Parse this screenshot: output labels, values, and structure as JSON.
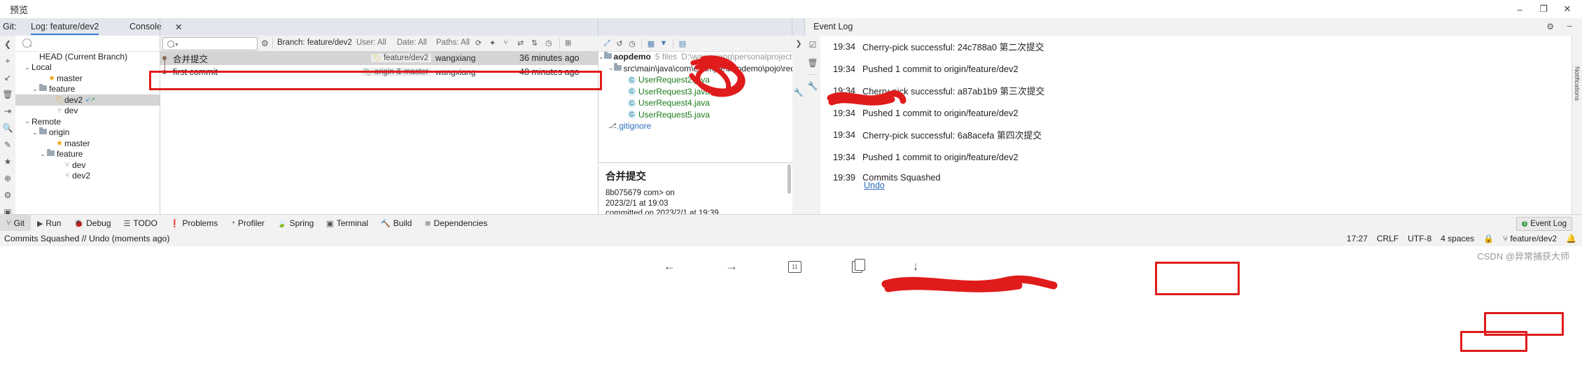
{
  "window": {
    "title": "预览",
    "minimize": "–",
    "maximize": "❐",
    "close": "✕"
  },
  "tabs": {
    "git_label": "Git:",
    "log_label": "Log: feature/dev2",
    "console_label": "Console",
    "close_icon": "✕"
  },
  "left_toolbar": [
    {
      "name": "collapse-icon",
      "glyph": "❮"
    },
    {
      "name": "add-icon",
      "glyph": "+"
    },
    {
      "name": "checkout-icon",
      "glyph": "↙"
    },
    {
      "name": "delete-icon",
      "glyph": "🗑"
    },
    {
      "name": "rebase-icon",
      "glyph": "⇥"
    },
    {
      "name": "search-icon",
      "glyph": "🔍"
    },
    {
      "name": "edit-icon",
      "glyph": "✎"
    },
    {
      "name": "favorite-icon",
      "glyph": "★"
    },
    {
      "name": "globe-icon",
      "glyph": "⊕"
    },
    {
      "name": "settings-icon",
      "glyph": "⚙"
    },
    {
      "name": "window-icon",
      "glyph": "▣"
    },
    {
      "name": "expand-icon",
      "glyph": "»"
    }
  ],
  "branch_tree": {
    "search_placeholder": "",
    "items": [
      {
        "label": "HEAD (Current Branch)",
        "indent": 2,
        "icon": "none",
        "chevron": "",
        "selected": false
      },
      {
        "label": "Local",
        "indent": 1,
        "icon": "none",
        "chevron": "⌄",
        "selected": false
      },
      {
        "label": "master",
        "indent": 3,
        "icon": "star",
        "chevron": "",
        "selected": false
      },
      {
        "label": "feature",
        "indent": 2,
        "icon": "folder",
        "chevron": "⌄",
        "selected": false
      },
      {
        "label": "dev2",
        "indent": 4,
        "icon": "tag",
        "chevron": "",
        "selected": true,
        "arrows": true
      },
      {
        "label": "dev",
        "indent": 4,
        "icon": "branch",
        "chevron": "",
        "selected": false
      },
      {
        "label": "Remote",
        "indent": 1,
        "icon": "none",
        "chevron": "⌄",
        "selected": false
      },
      {
        "label": "origin",
        "indent": 2,
        "icon": "folder",
        "chevron": "⌄",
        "selected": false
      },
      {
        "label": "master",
        "indent": 4,
        "icon": "star",
        "chevron": "",
        "selected": false
      },
      {
        "label": "feature",
        "indent": 3,
        "icon": "folder",
        "chevron": "⌄",
        "selected": false
      },
      {
        "label": "dev",
        "indent": 5,
        "icon": "branch",
        "chevron": "",
        "selected": false
      },
      {
        "label": "dev2",
        "indent": 5,
        "icon": "branch",
        "chevron": "",
        "selected": false
      }
    ]
  },
  "log_toolbar": {
    "search_placeholder": "",
    "gear_icon": "⚙",
    "filters": [
      {
        "name": "branch-filter",
        "key": "Branch:",
        "value": "feature/dev2"
      },
      {
        "name": "user-filter",
        "key": "User:",
        "value": "All"
      },
      {
        "name": "date-filter",
        "key": "Date:",
        "value": "All"
      },
      {
        "name": "paths-filter",
        "key": "Paths:",
        "value": "All"
      }
    ],
    "icons": [
      {
        "name": "refresh-icon",
        "glyph": "⟳"
      },
      {
        "name": "highlight-icon",
        "glyph": "✦"
      },
      {
        "name": "branch-graph-icon",
        "glyph": "⑂"
      },
      {
        "name": "compare-icon",
        "glyph": "⇄"
      },
      {
        "name": "intellisort-icon",
        "glyph": "⇅"
      },
      {
        "name": "clock-icon",
        "glyph": "◷"
      },
      {
        "name": "new-tab-icon",
        "glyph": "⊞"
      },
      {
        "name": "collapse-all-icon",
        "glyph": "⊟"
      },
      {
        "name": "expand-all-icon",
        "glyph": "⊞"
      },
      {
        "name": "pause-icon",
        "glyph": "❚❚"
      },
      {
        "name": "find-icon",
        "glyph": "🔍"
      }
    ]
  },
  "commits": {
    "rows": [
      {
        "subject": "合并提交",
        "label": "feature/dev2",
        "label_color": "yellow",
        "author": "wangxiang",
        "date": "36 minutes ago",
        "selected": true
      },
      {
        "subject": "first commit",
        "label": "origin & master",
        "label_color": "green",
        "author": "wangxiang",
        "date": "48 minutes ago",
        "selected": false
      }
    ]
  },
  "changes_panel": {
    "toolbar_icons": [
      {
        "name": "expand-selection-icon",
        "glyph": "⤢"
      },
      {
        "name": "revert-icon",
        "glyph": "↺"
      },
      {
        "name": "history-icon",
        "glyph": "◷"
      },
      {
        "name": "group-by-icon",
        "glyph": "▦"
      },
      {
        "name": "filter-icon",
        "glyph": "▼"
      },
      {
        "name": "view-options-icon",
        "glyph": "▤"
      }
    ],
    "root": {
      "name": "aopdemo",
      "files": "5 files",
      "path": "D:\\wangxiang\\personalproject\\aopd"
    },
    "folder": "src\\main\\java\\com\\example\\aopdemo\\pojo\\reques",
    "files": [
      "UserRequest2.java",
      "UserRequest3.java",
      "UserRequest4.java",
      "UserRequest5.java"
    ],
    "gitignore": ".gitignore"
  },
  "commit_detail": {
    "title": "合并提交",
    "hash": "8b075679",
    "redacted_author": "",
    "suffix": "com> on",
    "date_line": "2023/2/1 at 19:03",
    "committed_line": "committed on 2023/2/1 at 19:39"
  },
  "right_gutter_icons": [
    {
      "name": "collapse-right-icon",
      "glyph": "❯"
    },
    {
      "name": "wrench-icon",
      "glyph": "🔧"
    }
  ],
  "event_log": {
    "title": "Event Log",
    "gear_icon": "⚙",
    "minimize_icon": "–",
    "toolbar_icons": [
      {
        "name": "mark-read-icon",
        "glyph": "☑"
      },
      {
        "name": "clear-all-icon",
        "glyph": "🗑"
      },
      {
        "name": "settings-wrench-icon",
        "glyph": "🔧"
      }
    ],
    "entries": [
      {
        "time": "19:34",
        "message": "Cherry-pick successful: 24c788a0 第二次提交",
        "link": "",
        "highlighted": false
      },
      {
        "time": "19:34",
        "message": "Pushed 1 commit to origin/feature/dev2",
        "link": "",
        "highlighted": false
      },
      {
        "time": "19:34",
        "message": "Cherry-pick successful: a87ab1b9 第三次提交",
        "link": "",
        "highlighted": false
      },
      {
        "time": "19:34",
        "message": "Pushed 1 commit to origin/feature/dev2",
        "link": "",
        "highlighted": false
      },
      {
        "time": "19:34",
        "message": "Cherry-pick successful: 6a8acefa 第四次提交",
        "link": "",
        "highlighted": false
      },
      {
        "time": "19:34",
        "message": "Pushed 1 commit to origin/feature/dev2",
        "link": "",
        "highlighted": false
      },
      {
        "time": "19:39",
        "message": "Commits Squashed",
        "link": "Undo",
        "highlighted": true
      }
    ]
  },
  "right_edge": {
    "label": "Notifications"
  },
  "bottom_bar": {
    "items": [
      {
        "label": "Git",
        "icon": "⑂",
        "active": true
      },
      {
        "label": "Run",
        "icon": "▶",
        "active": false
      },
      {
        "label": "Debug",
        "icon": "🐞",
        "active": false
      },
      {
        "label": "TODO",
        "icon": "☰",
        "active": false
      },
      {
        "label": "Problems",
        "icon": "❗",
        "active": false
      },
      {
        "label": "Profiler",
        "icon": "◔",
        "active": false
      },
      {
        "label": "Spring",
        "icon": "🍃",
        "active": false
      },
      {
        "label": "Terminal",
        "icon": "▣",
        "active": false
      },
      {
        "label": "Build",
        "icon": "🔨",
        "active": false
      },
      {
        "label": "Dependencies",
        "icon": "≋",
        "active": false
      }
    ],
    "event_log_button": {
      "label": "Event Log",
      "badge": "1"
    }
  },
  "status_bar": {
    "message": "Commits Squashed // Undo (moments ago)",
    "caret": "17:27",
    "line_separator": "CRLF",
    "encoding": "UTF-8",
    "indent": "4 spaces",
    "branch": "feature/dev2",
    "lock_icon": "🔒",
    "branch_icon": "⑂"
  },
  "nav_bar": {
    "back_icon": "←",
    "forward_icon": "→",
    "recents_icon": "11",
    "copy_icon": "❐",
    "download_icon": "↓",
    "ime_hint": "",
    "watermark": "CSDN @异常捕获大师"
  }
}
